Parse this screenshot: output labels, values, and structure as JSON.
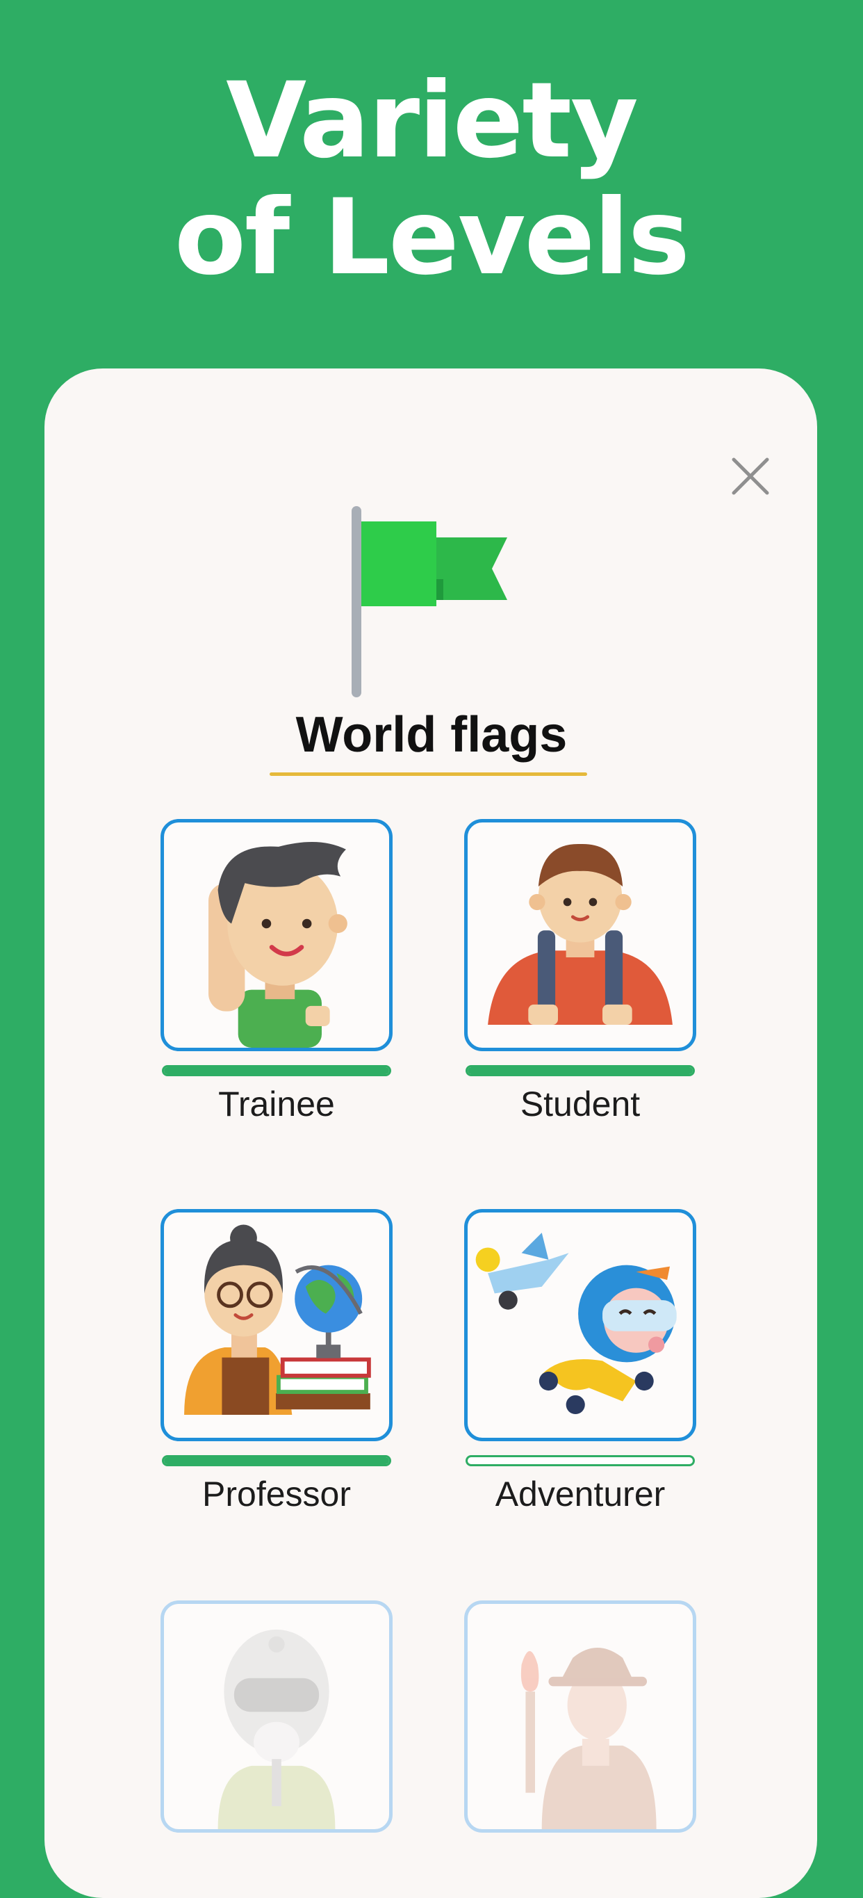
{
  "headline": {
    "line1": "Variety",
    "line2": "of Levels"
  },
  "deck": {
    "title": "World flags",
    "icon": "green-flag-icon"
  },
  "close": {
    "icon": "close-icon"
  },
  "colors": {
    "background": "#2ead64",
    "card": "#faf7f5",
    "tile_border": "#1f8fd9",
    "progress": "#2ead64",
    "underline": "#e5b93a"
  },
  "levels": [
    {
      "label": "Trainee",
      "progress": 1.0,
      "locked": false,
      "icon": "trainee-avatar-icon"
    },
    {
      "label": "Student",
      "progress": 1.0,
      "locked": false,
      "icon": "student-avatar-icon"
    },
    {
      "label": "Professor",
      "progress": 1.0,
      "locked": false,
      "icon": "professor-avatar-icon"
    },
    {
      "label": "Adventurer",
      "progress": 0.0,
      "locked": false,
      "icon": "adventurer-avatar-icon"
    },
    {
      "label": "",
      "progress": null,
      "locked": true,
      "icon": "pilot-avatar-icon"
    },
    {
      "label": "",
      "progress": null,
      "locked": true,
      "icon": "explorer-avatar-icon"
    }
  ]
}
